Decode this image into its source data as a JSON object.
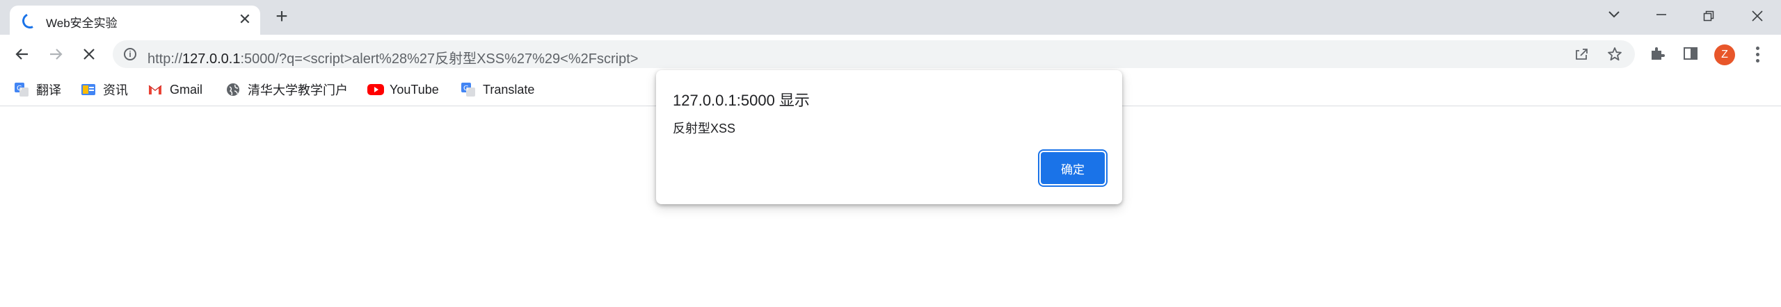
{
  "tab": {
    "title": "Web安全实验",
    "close_glyph": "✕",
    "new_tab_glyph": "+"
  },
  "omnibox": {
    "url_prefix": "http://",
    "url_host": "127.0.0.1",
    "url_rest": ":5000/?q=<script>alert%28%27反射型XSS%27%29<%2Fscript>"
  },
  "profile": {
    "initial": "Z",
    "color": "#e8562a"
  },
  "bookmarks": [
    {
      "label": "翻译",
      "icon": "google-translate-icon"
    },
    {
      "label": "资讯",
      "icon": "google-news-icon"
    },
    {
      "label": "Gmail",
      "icon": "gmail-icon"
    },
    {
      "label": "清华大学教学门户",
      "icon": "globe-icon"
    },
    {
      "label": "YouTube",
      "icon": "youtube-icon"
    },
    {
      "label": "Translate",
      "icon": "google-translate-icon"
    }
  ],
  "dialog": {
    "title": "127.0.0.1:5000 显示",
    "message": "反射型XSS",
    "ok_label": "确定"
  },
  "colors": {
    "accent": "#1a73e8",
    "tabstrip": "#dee1e6",
    "omnibox": "#f1f3f4"
  }
}
